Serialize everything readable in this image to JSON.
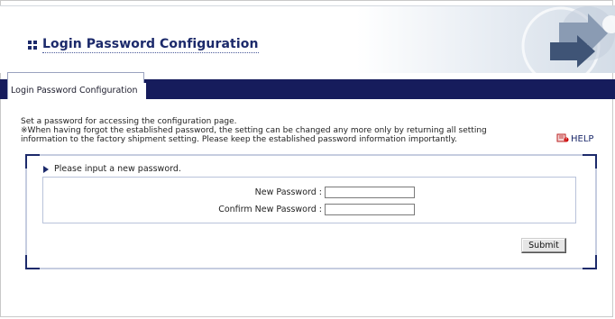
{
  "header": {
    "title": "Login Password Configuration"
  },
  "tabs": [
    {
      "label": "Login Password Configuration"
    }
  ],
  "description": {
    "line1": "Set a password for accessing the configuration page.",
    "line2": "※When having forgot the established password, the setting can be changed any more only by returning all setting",
    "line3": "information to the factory shipment setting. Please keep the established password information importantly."
  },
  "help": {
    "label": "HELP",
    "icon": "help-book-icon"
  },
  "form": {
    "prompt": "Please input a new password.",
    "new_password_label": "New Password :",
    "new_password_value": "",
    "confirm_password_label": "Confirm New Password :",
    "confirm_password_value": "",
    "submit_label": "Submit"
  },
  "colors": {
    "accent": "#1c2a6b",
    "tab_bar": "#161c5c",
    "panel_edge": "#c6cde0"
  }
}
